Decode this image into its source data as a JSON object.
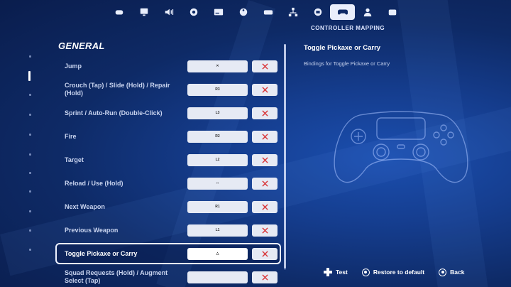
{
  "nav": {
    "caption": "CONTROLLER MAPPING",
    "tabs": [
      {
        "icon": "gamepad-small-icon"
      },
      {
        "icon": "display-icon"
      },
      {
        "icon": "volume-icon"
      },
      {
        "icon": "gear-icon"
      },
      {
        "icon": "subtitles-icon"
      },
      {
        "icon": "accessibility-icon"
      },
      {
        "icon": "touch-controls-icon"
      },
      {
        "icon": "network-icon"
      },
      {
        "icon": "keyboard-mouse-icon"
      },
      {
        "icon": "controller-icon",
        "active": true
      },
      {
        "icon": "account-icon"
      },
      {
        "icon": "replay-icon"
      }
    ]
  },
  "section": {
    "title": "GENERAL"
  },
  "bindings": [
    {
      "label": "Jump",
      "value": "✕"
    },
    {
      "label": "Crouch (Tap) / Slide (Hold) / Repair (Hold)",
      "value": "R3"
    },
    {
      "label": "Sprint / Auto-Run (Double-Click)",
      "value": "L3"
    },
    {
      "label": "Fire",
      "value": "R2"
    },
    {
      "label": "Target",
      "value": "L2"
    },
    {
      "label": "Reload / Use (Hold)",
      "value": "□"
    },
    {
      "label": "Next Weapon",
      "value": "R1"
    },
    {
      "label": "Previous Weapon",
      "value": "L1"
    },
    {
      "label": "Toggle Pickaxe or Carry",
      "value": "△",
      "selected": true
    },
    {
      "label": "Squad Requests (Hold) / Augment Select (Tap)",
      "value": ""
    }
  ],
  "detail": {
    "title": "Toggle Pickaxe or Carry",
    "subtitle": "Bindings for Toggle Pickaxe or Carry"
  },
  "footer": {
    "test": "Test",
    "restore": "Restore to default",
    "back": "Back"
  },
  "colors": {
    "accent": "#e9eefc",
    "clear_x": "#d9383b",
    "bg": "#153d8e"
  }
}
